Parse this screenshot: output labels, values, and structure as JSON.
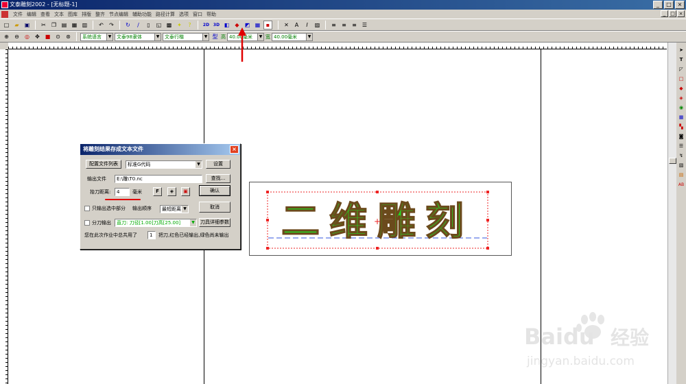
{
  "window": {
    "title": "文泰雕刻2002 - [无标题-1]",
    "min": "_",
    "max": "□",
    "close": "×"
  },
  "menu": {
    "items": [
      "文件",
      "编辑",
      "查看",
      "文本",
      "图库",
      "排版",
      "整齐",
      "节点编辑",
      "辅助功能",
      "路径计算",
      "选项",
      "窗口",
      "帮助"
    ]
  },
  "toolbar2": {
    "lang": "系统语言",
    "font1": "文泰98隶体",
    "font2": "文泰行楷",
    "height_label": "高",
    "height_value": "40.00毫米",
    "width_label": "宽",
    "width_value": "40.00毫米"
  },
  "dialog": {
    "title": "将雕刻结果存成文本文件",
    "config_button": "配置文件列表",
    "config_value": "标准G代码",
    "settings_button": "设置",
    "output_label": "输出文件",
    "output_value": "E:\\雕\\T0.nc",
    "browse_button": "查找...",
    "lift_label": "抬刀距离:",
    "lift_value": "4",
    "lift_unit": "毫米",
    "confirm_button": "确认",
    "only_selected_label": "只输出选中部分",
    "order_label": "输出顺序",
    "order_value": "最短距离",
    "cancel_button": "取消",
    "split_label": "分刀输出",
    "split_value": "直刀: 刀径[1.00]刀高[25.00]",
    "tool_params_button": "刀具详细参数",
    "summary_pre": "您在此次作业中总共用了",
    "summary_count": "1",
    "summary_post": "把刀,红色已经输出,绿色尚未输出"
  },
  "preview": {
    "text": "二维雕刻",
    "fill_color": "#22dd22",
    "outline_color": "#6b4a1c",
    "selection_color": "#ee2222"
  },
  "watermark": {
    "brand": "Baidu",
    "product": "经验",
    "url": "jingyan.baidu.com"
  },
  "colors": {
    "titlebar": "#0a246a",
    "face": "#d4d0c8",
    "annotation_red": "#e00000"
  }
}
